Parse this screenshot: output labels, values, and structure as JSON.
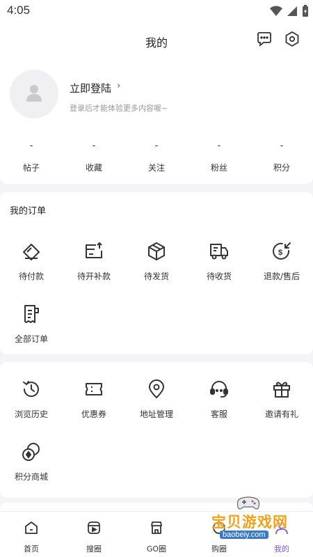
{
  "status_bar": {
    "time": "4:05"
  },
  "header": {
    "title": "我的",
    "message_icon": "message-icon",
    "settings_icon": "settings-icon"
  },
  "profile": {
    "login_label": "立即登陆",
    "chevron": "›",
    "subtitle": "登录后才能体验更多内容喔~",
    "stats": [
      {
        "value": "-",
        "label": "帖子"
      },
      {
        "value": "-",
        "label": "收藏"
      },
      {
        "value": "-",
        "label": "关注"
      },
      {
        "value": "-",
        "label": "粉丝"
      },
      {
        "value": "-",
        "label": "积分"
      }
    ]
  },
  "orders": {
    "title": "我的订单",
    "items": [
      {
        "label": "待付款",
        "icon": "pending-payment-icon"
      },
      {
        "label": "待开补款",
        "icon": "supplement-payment-icon"
      },
      {
        "label": "待发货",
        "icon": "package-icon"
      },
      {
        "label": "待收货",
        "icon": "delivery-truck-icon"
      },
      {
        "label": "退款/售后",
        "icon": "refund-icon"
      },
      {
        "label": "全部订单",
        "icon": "receipt-icon"
      }
    ]
  },
  "services": {
    "items": [
      {
        "label": "浏览历史",
        "icon": "history-icon"
      },
      {
        "label": "优惠券",
        "icon": "coupon-icon"
      },
      {
        "label": "地址管理",
        "icon": "location-icon"
      },
      {
        "label": "客服",
        "icon": "headset-icon"
      },
      {
        "label": "邀请有礼",
        "icon": "gift-icon"
      },
      {
        "label": "积分商城",
        "icon": "points-mall-icon"
      }
    ]
  },
  "tabbar": {
    "tabs": [
      {
        "label": "首页",
        "icon": "home-icon"
      },
      {
        "label": "搜圈",
        "icon": "video-icon"
      },
      {
        "label": "GO圈",
        "icon": "go-circle-icon"
      },
      {
        "label": "购圈",
        "icon": "shop-icon"
      },
      {
        "label": "我的",
        "icon": "profile-icon"
      }
    ],
    "active_color": "#7d56e8"
  },
  "watermark": {
    "title": "宝贝游戏网",
    "url": "baobeiy.com"
  }
}
